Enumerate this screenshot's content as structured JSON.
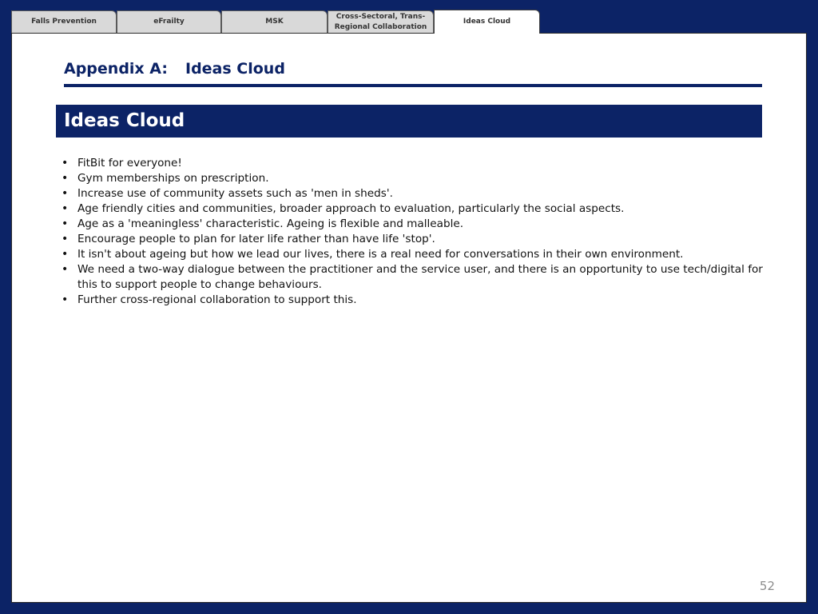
{
  "tabs": [
    {
      "label": "Falls Prevention",
      "active": false
    },
    {
      "label": "eFrailty",
      "active": false
    },
    {
      "label": "MSK",
      "active": false
    },
    {
      "label": "Cross-Sectoral, Trans-\nRegional Collaboration",
      "active": false
    },
    {
      "label": "Ideas Cloud",
      "active": true
    }
  ],
  "header": {
    "appendix_label": "Appendix A:",
    "appendix_title": "Ideas Cloud"
  },
  "section": {
    "title": "Ideas Cloud"
  },
  "bullet_glyph": "•",
  "ideas": [
    "FitBit for everyone!",
    "Gym memberships on prescription.",
    "Increase use of community assets such as 'men in sheds'.",
    "Age friendly cities and communities, broader approach to evaluation, particularly the social aspects.",
    "Age as a 'meaningless' characteristic. Ageing is flexible and malleable.",
    "Encourage people to plan for later life rather than have life 'stop'.",
    "It isn't about ageing but how we lead our lives, there is a real need for conversations in their own environment.",
    "We need a two-way dialogue between the practitioner and the service user, and there is an opportunity to use tech/digital for this to support people to change behaviours.",
    "Further cross-regional collaboration to support this."
  ],
  "footer": {
    "page_number": "52"
  },
  "colors": {
    "navy": "#0c2366",
    "tab_inactive": "#d9d9d9",
    "page_number": "#8c8c8c"
  }
}
